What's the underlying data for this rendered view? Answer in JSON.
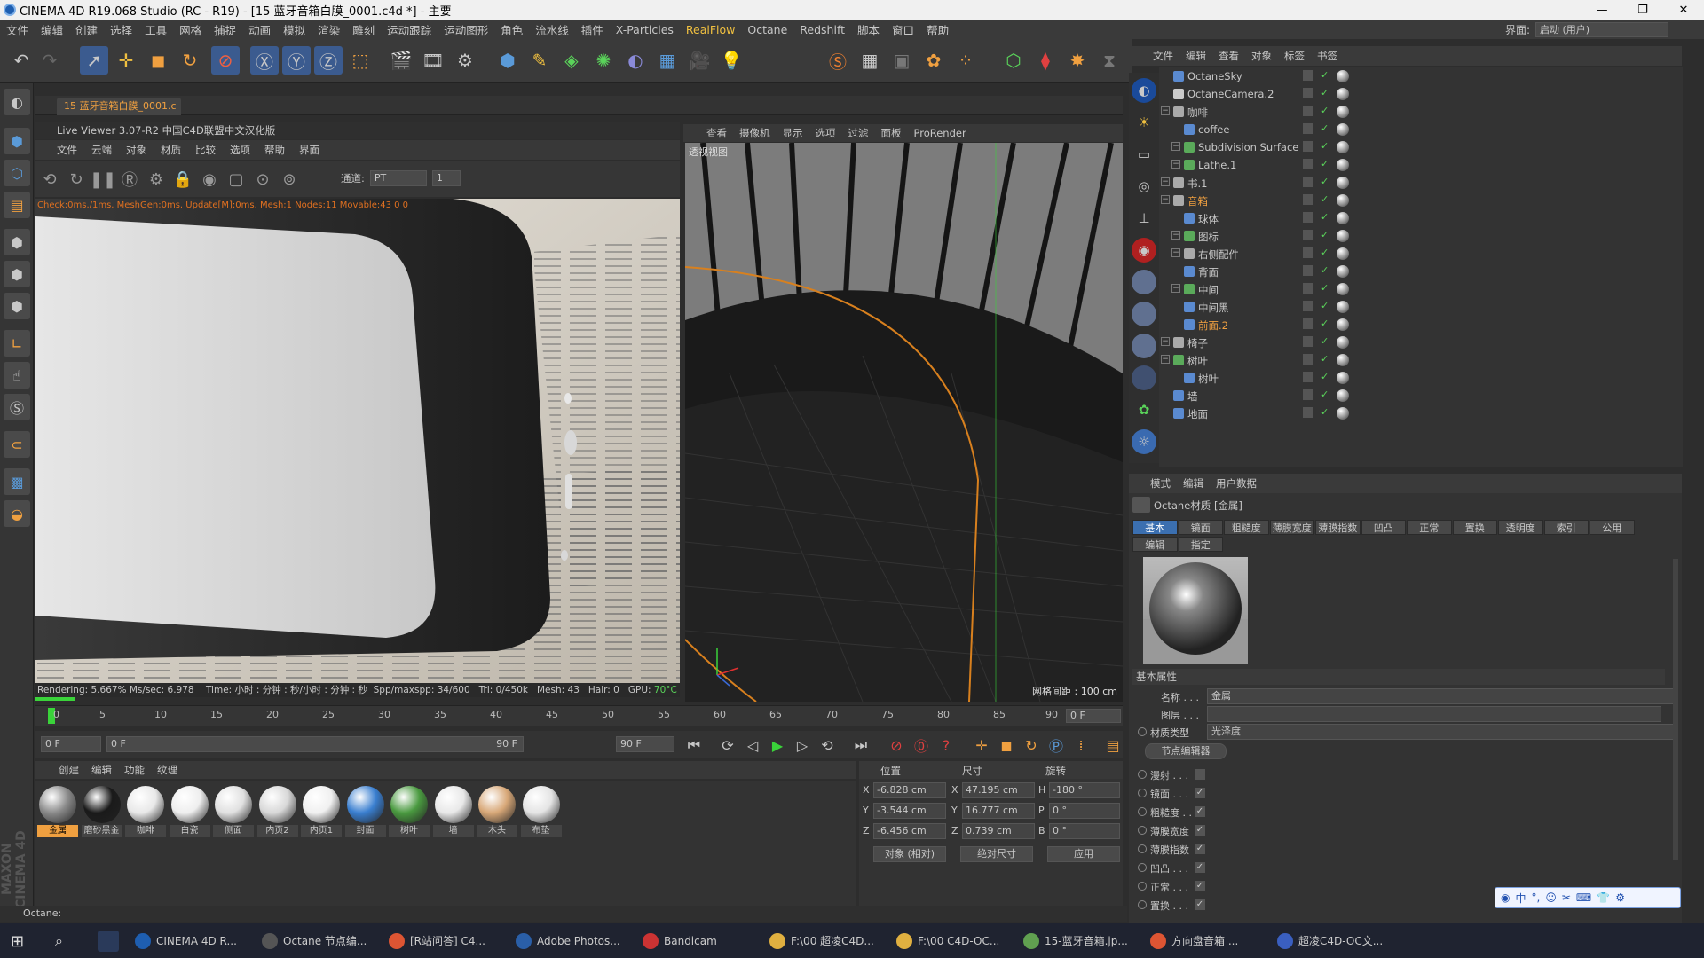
{
  "window": {
    "title": "CINEMA 4D R19.068 Studio (RC - R19) - [15 蓝牙音箱白膜_0001.c4d *] - 主要",
    "min": "—",
    "max": "❐",
    "close": "✕"
  },
  "menu": [
    "文件",
    "编辑",
    "创建",
    "选择",
    "工具",
    "网格",
    "捕捉",
    "动画",
    "模拟",
    "渲染",
    "雕刻",
    "运动跟踪",
    "运动图形",
    "角色",
    "流水线",
    "插件",
    "X-Particles",
    "RealFlow",
    "Octane",
    "Redshift",
    "脚本",
    "窗口",
    "帮助"
  ],
  "layout": {
    "label": "界面:",
    "value": "启动 (用户)"
  },
  "doc_tab": "15 蓝牙音箱白膜_0001.c",
  "live_viewer": {
    "title": "Live Viewer 3.07-R2 中国C4D联盟中文汉化版",
    "menu": [
      "文件",
      "云端",
      "对象",
      "材质",
      "比较",
      "选项",
      "帮助",
      "界面"
    ],
    "channel_label": "通道:",
    "channel_value": "PT",
    "channel_num": "1",
    "stat_line": "Check:0ms./1ms. MeshGen:0ms. Update[M]:0ms. Mesh:1 Nodes:11 Movable:43 0 0",
    "status": {
      "rendering": "Rendering: 5.667%",
      "ms": "Ms/sec: 6.978",
      "time": "Time: 小时 : 分钟 : 秒/小时 : 分钟 : 秒",
      "spp": "Spp/maxspp: 34/600",
      "tri": "Tri: 0/450k",
      "mesh": "Mesh: 43",
      "hair": "Hair: 0",
      "gpu": "GPU:",
      "temp": "70°C"
    }
  },
  "viewport": {
    "menu": [
      "查看",
      "摄像机",
      "显示",
      "选项",
      "过滤",
      "面板",
      "ProRender"
    ],
    "label": "透视视图",
    "grid": "网格间距 : 100 cm"
  },
  "timeline": {
    "ticks": [
      "0",
      "5",
      "10",
      "15",
      "20",
      "25",
      "30",
      "35",
      "40",
      "45",
      "50",
      "55",
      "60",
      "65",
      "70",
      "75",
      "80",
      "85",
      "90"
    ],
    "frame": "0 F",
    "start": "0 F",
    "cur": "0 F",
    "end_slider": "90 F",
    "end": "90 F"
  },
  "materials": {
    "menu": [
      "创建",
      "编辑",
      "功能",
      "纹理"
    ],
    "items": [
      {
        "name": "金属",
        "color": "#8a8a8a"
      },
      {
        "name": "磨砂黑金",
        "color": "#1a1a1a"
      },
      {
        "name": "咖啡",
        "color": "#e8e8e8"
      },
      {
        "name": "白瓷",
        "color": "#eeeeee"
      },
      {
        "name": "侧面",
        "color": "#e0e0e0"
      },
      {
        "name": "内页2",
        "color": "#d8d8d8"
      },
      {
        "name": "内页1",
        "color": "#f0f0f0"
      },
      {
        "name": "封面",
        "color": "#3a7fd0"
      },
      {
        "name": "树叶",
        "color": "#4a9a40"
      },
      {
        "name": "墙",
        "color": "#e8e8e8"
      },
      {
        "name": "木头",
        "color": "#d8a878"
      },
      {
        "name": "布垫",
        "color": "#e4e4e4"
      }
    ]
  },
  "coords": {
    "headers": [
      "位置",
      "尺寸",
      "旋转"
    ],
    "rows": [
      {
        "a": "X",
        "p": "-6.828 cm",
        "s": "47.195 cm",
        "r_axis": "H",
        "r": "-180 °"
      },
      {
        "a": "Y",
        "p": "-3.544 cm",
        "s": "16.777 cm",
        "r_axis": "P",
        "r": "0 °"
      },
      {
        "a": "Z",
        "p": "-6.456 cm",
        "s": "0.739 cm",
        "r_axis": "B",
        "r": "0 °"
      }
    ],
    "mode1": "对象 (相对)",
    "mode2": "绝对尺寸",
    "apply": "应用"
  },
  "status_text": "Octane:",
  "objects": {
    "menu": [
      "文件",
      "编辑",
      "查看",
      "对象",
      "标签",
      "书签"
    ],
    "rows": [
      {
        "name": "OctaneSky",
        "indent": 0,
        "color": "#5a8ad0",
        "exp": false,
        "hl": false
      },
      {
        "name": "OctaneCamera.2",
        "indent": 0,
        "color": "#cccccc",
        "exp": false,
        "hl": false
      },
      {
        "name": "咖啡",
        "indent": 0,
        "color": "#aaaaaa",
        "exp": true,
        "hl": false
      },
      {
        "name": "coffee",
        "indent": 1,
        "color": "#5a8ad0",
        "exp": false,
        "hl": false
      },
      {
        "name": "Subdivision Surface",
        "indent": 1,
        "color": "#5aaa5a",
        "exp": true,
        "hl": false
      },
      {
        "name": "Lathe.1",
        "indent": 1,
        "color": "#5aaa5a",
        "exp": true,
        "hl": false
      },
      {
        "name": "书.1",
        "indent": 0,
        "color": "#aaaaaa",
        "exp": true,
        "hl": false
      },
      {
        "name": "音箱",
        "indent": 0,
        "color": "#aaaaaa",
        "exp": true,
        "hl": true
      },
      {
        "name": "球体",
        "indent": 1,
        "color": "#5a8ad0",
        "exp": false,
        "hl": false
      },
      {
        "name": "图标",
        "indent": 1,
        "color": "#5aaa5a",
        "exp": true,
        "hl": false
      },
      {
        "name": "右侧配件",
        "indent": 1,
        "color": "#aaaaaa",
        "exp": true,
        "hl": false
      },
      {
        "name": "背面",
        "indent": 1,
        "color": "#5a8ad0",
        "exp": false,
        "hl": false
      },
      {
        "name": "中间",
        "indent": 1,
        "color": "#5aaa5a",
        "exp": true,
        "hl": false
      },
      {
        "name": "中间黑",
        "indent": 1,
        "color": "#5a8ad0",
        "exp": false,
        "hl": false
      },
      {
        "name": "前面.2",
        "indent": 1,
        "color": "#5a8ad0",
        "exp": false,
        "hl": true
      },
      {
        "name": "椅子",
        "indent": 0,
        "color": "#aaaaaa",
        "exp": true,
        "hl": false
      },
      {
        "name": "树叶",
        "indent": 0,
        "color": "#5aaa5a",
        "exp": true,
        "hl": false
      },
      {
        "name": "树叶",
        "indent": 1,
        "color": "#5a8ad0",
        "exp": false,
        "hl": false
      },
      {
        "name": "墙",
        "indent": 0,
        "color": "#5a8ad0",
        "exp": false,
        "hl": false
      },
      {
        "name": "地面",
        "indent": 0,
        "color": "#5a8ad0",
        "exp": false,
        "hl": false
      }
    ]
  },
  "attributes": {
    "menu": [
      "模式",
      "编辑",
      "用户数据"
    ],
    "title": "Octane材质 [金属]",
    "tabs": [
      "基本",
      "镜面",
      "粗糙度",
      "薄膜宽度",
      "薄膜指数",
      "凹凸",
      "正常",
      "置换",
      "透明度",
      "索引",
      "公用"
    ],
    "tabs2": [
      "编辑",
      "指定"
    ],
    "section": "基本属性",
    "name_label": "名称 . . .",
    "name_value": "金属",
    "layer_label": "图层 . . .",
    "layer_value": "",
    "type_label": "材质类型",
    "type_value": "光泽度",
    "node_btn": "节点编辑器",
    "checks": [
      {
        "label": "漫射 . . .",
        "mark": ""
      },
      {
        "label": "镜面 . . .",
        "mark": "✓"
      },
      {
        "label": "粗糙度 . .",
        "mark": "✓"
      },
      {
        "label": "薄膜宽度",
        "mark": "✓"
      },
      {
        "label": "薄膜指数",
        "mark": "✓"
      },
      {
        "label": "凹凸 . . .",
        "mark": "✓"
      },
      {
        "label": "正常 . . .",
        "mark": "✓"
      },
      {
        "label": "置换 . . .",
        "mark": "✓"
      }
    ]
  },
  "ime": "中",
  "taskbar": [
    {
      "label": "CINEMA 4D R...",
      "color": "#1e5eb0"
    },
    {
      "label": "Octane 节点编...",
      "color": "#555555"
    },
    {
      "label": "[R站问答] C4...",
      "color": "#dd5533"
    },
    {
      "label": "Adobe Photos...",
      "color": "#2a5fa8"
    },
    {
      "label": "Bandicam",
      "color": "#cc3333"
    },
    {
      "label": "F:\\00 超凌C4D...",
      "color": "#e0b040"
    },
    {
      "label": "F:\\00 C4D-OC...",
      "color": "#e0b040"
    },
    {
      "label": "15-蓝牙音箱.jp...",
      "color": "#60a050"
    },
    {
      "label": "方向盘音箱 ...",
      "color": "#dd5533"
    },
    {
      "label": "超凌C4D-OC文...",
      "color": "#3a5fc0"
    }
  ]
}
